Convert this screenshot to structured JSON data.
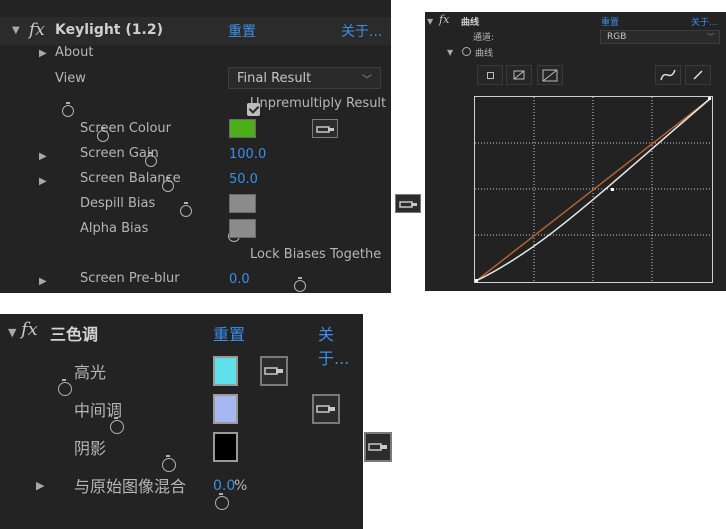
{
  "keylight": {
    "title": "Keylight (1.2)",
    "reset": "重置",
    "about_link": "关于...",
    "about_label": "About",
    "view_label": "View",
    "view_value": "Final Result",
    "unpremultiply_label": "Unpremultiply Result",
    "screen_colour_label": "Screen Colour",
    "screen_colour": "#4caf1a",
    "screen_gain_label": "Screen Gain",
    "screen_gain_value": "100.0",
    "screen_balance_label": "Screen Balance",
    "screen_balance_value": "50.0",
    "despill_label": "Despill Bias",
    "alpha_label": "Alpha Bias",
    "bias_colour": "#8c8c8c",
    "lock_label": "Lock Biases Togethe",
    "preblur_label": "Screen Pre-blur",
    "preblur_value": "0.0"
  },
  "curves": {
    "title": "曲线",
    "reset": "重置",
    "about_link": "关于...",
    "channel_label": "通道:",
    "channel_value": "RGB",
    "curve_label": "曲线"
  },
  "tritone": {
    "title": "三色调",
    "reset": "重置",
    "about_link": "关于...",
    "highlights_label": "高光",
    "highlights_color": "#5ee0e8",
    "midtones_label": "中间调",
    "midtones_color": "#a7b7f2",
    "shadows_label": "阴影",
    "shadows_color": "#000000",
    "blend_label": "与原始图像混合",
    "blend_value": "0.0",
    "blend_unit": "%"
  }
}
